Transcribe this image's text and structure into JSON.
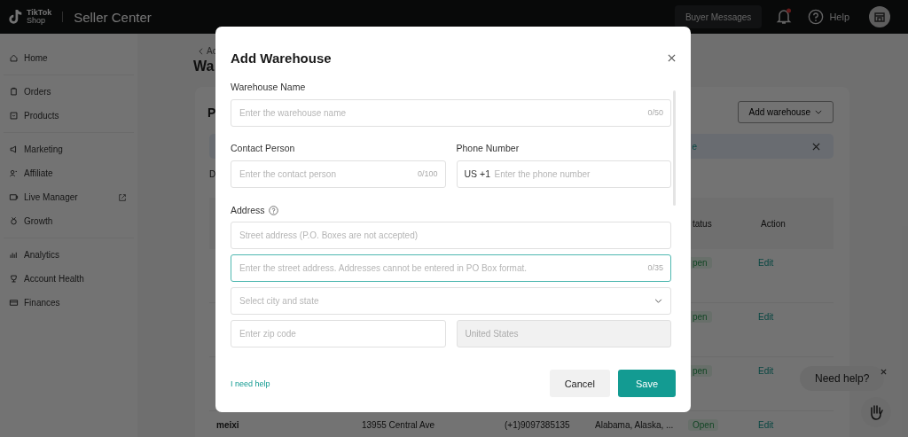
{
  "topbar": {
    "logo_top": "TikTok",
    "logo_bottom": "Shop",
    "product": "Seller Center",
    "messages_button": "Buyer Messages",
    "has_notification": true,
    "help": "Help"
  },
  "sidebar": {
    "groups": [
      [
        {
          "label": "Home",
          "external": false
        }
      ],
      [
        {
          "label": "Orders",
          "external": false
        },
        {
          "label": "Products",
          "external": false
        }
      ],
      [
        {
          "label": "Marketing",
          "external": false
        },
        {
          "label": "Affiliate",
          "external": false
        },
        {
          "label": "Live Manager",
          "external": true
        },
        {
          "label": "Growth",
          "external": false
        }
      ],
      [
        {
          "label": "Analytics",
          "external": false
        },
        {
          "label": "Account Health",
          "external": false
        },
        {
          "label": "Finances",
          "external": false
        }
      ]
    ]
  },
  "page": {
    "breadcrumb": "Ac",
    "title": "Wa",
    "card": {
      "heading": "P",
      "add_button": "Add warehouse",
      "banner_text": "e",
      "description": "D",
      "table": {
        "columns": [
          "tatus",
          "Action"
        ],
        "rows": [
          {
            "column_1": "",
            "column_2": "",
            "column_3": "",
            "column_4": "",
            "status": "pen",
            "action": "Edit"
          },
          {
            "column_1": "",
            "column_2": "",
            "column_3": "",
            "column_4": "",
            "status": "pen",
            "action": "Edit"
          },
          {
            "column_1": "",
            "column_2": "",
            "column_3": "",
            "column_4": "",
            "status": "pen",
            "action": "Edit"
          },
          {
            "column_1": "meixi",
            "column_2": "13955 Central Ave",
            "column_3": "(+1)9097385135",
            "column_4": "Alabama, Alaska, ...",
            "status": "Open",
            "action": "Edit"
          }
        ]
      }
    }
  },
  "help_widget": {
    "text": "Need help?"
  },
  "dialog": {
    "title": "Add Warehouse",
    "warehouse_name": {
      "label": "Warehouse Name",
      "placeholder": "Enter the warehouse name",
      "counter": "0/50"
    },
    "contact_person": {
      "label": "Contact Person",
      "placeholder": "Enter the contact person",
      "counter": "0/100"
    },
    "phone_number": {
      "label": "Phone Number",
      "prefix": "US +1",
      "placeholder": "Enter the phone number"
    },
    "address": {
      "label": "Address",
      "street": {
        "placeholder": "Street address (P.O. Boxes are not accepted)",
        "focused": false
      },
      "street_line": {
        "placeholder": "Enter the street address. Addresses cannot be entered in PO Box format.",
        "counter": "0/35",
        "focused": true
      },
      "city_state": {
        "placeholder": "Select city and state"
      },
      "zip": {
        "placeholder": "Enter zip code"
      },
      "country": {
        "value": "United States",
        "disabled": true
      }
    },
    "help_link": "I need help",
    "buttons": [
      {
        "label": "Cancel",
        "kind": "secondary"
      },
      {
        "label": "Save",
        "kind": "primary"
      }
    ]
  }
}
